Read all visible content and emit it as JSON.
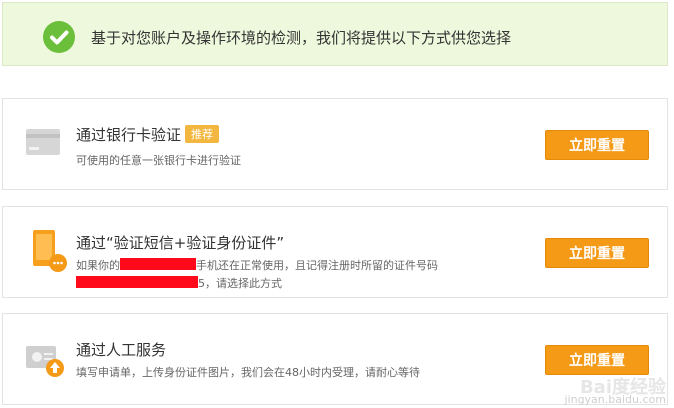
{
  "banner": {
    "text": "基于对您账户及操作环境的检测，我们将提供以下方式供您选择",
    "icon": "check-circle-icon"
  },
  "options": [
    {
      "title": "通过银行卡验证",
      "badge": "推荐",
      "desc1": "可使用的任意一张银行卡进行验证",
      "button": "立即重置",
      "icon": "bank-card-icon"
    },
    {
      "title": "通过“验证短信+验证身份证件”",
      "desc1_prefix": "如果你的",
      "desc1_suffix": "手机还在正常使用，且记得注册时所留的证件号码",
      "desc2_suffix": "5，请选择此方式",
      "button": "立即重置",
      "icon": "phone-sms-icon"
    },
    {
      "title": "通过人工服务",
      "desc1": "填写申请单，上传身份证件图片，我们会在48小时内受理，请耐心等待",
      "button": "立即重置",
      "icon": "id-upload-icon"
    }
  ],
  "watermark": {
    "line1": "Bai度经验",
    "line2": "jingyan.baidu.com"
  },
  "colors": {
    "banner_bg": "#eef8dd",
    "check": "#6bbf3b",
    "button": "#f49a16",
    "badge": "#f3b73f",
    "redaction": "#ff0a1a"
  }
}
